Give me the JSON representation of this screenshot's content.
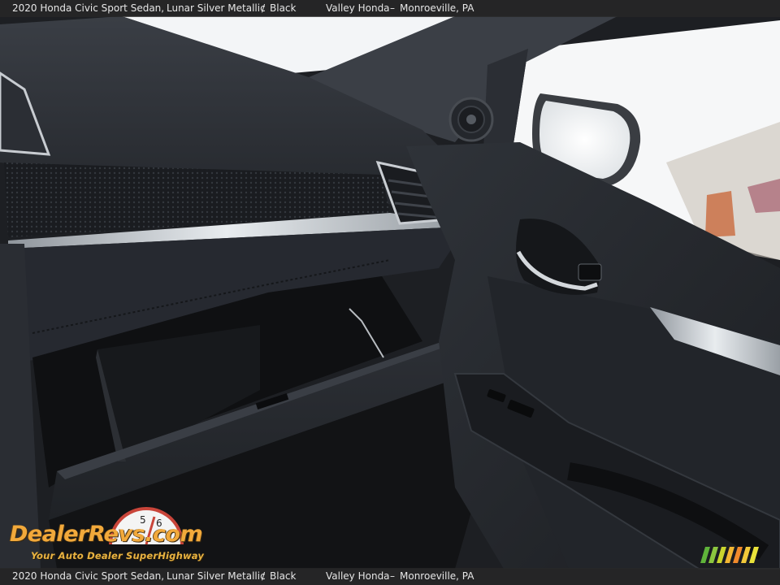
{
  "caption": {
    "vehicle": "2020 Honda Civic Sport Sedan,",
    "color": "Lunar Silver Metallic",
    "separator": "/",
    "interior": "Black",
    "dealer": "Valley Honda",
    "dash": "–",
    "location": "Monroeville, PA"
  },
  "watermark": {
    "brand": "DealerRevs.com",
    "tagline": "Your Auto Dealer SuperHighway",
    "colors": {
      "primary": "#f2a93b",
      "accent": "#8bbf3a"
    }
  },
  "colors": {
    "dashboard": "#2a2d33",
    "trim": "#d9dde2",
    "windshield": "#f4f6f8",
    "bar": "#282828"
  }
}
